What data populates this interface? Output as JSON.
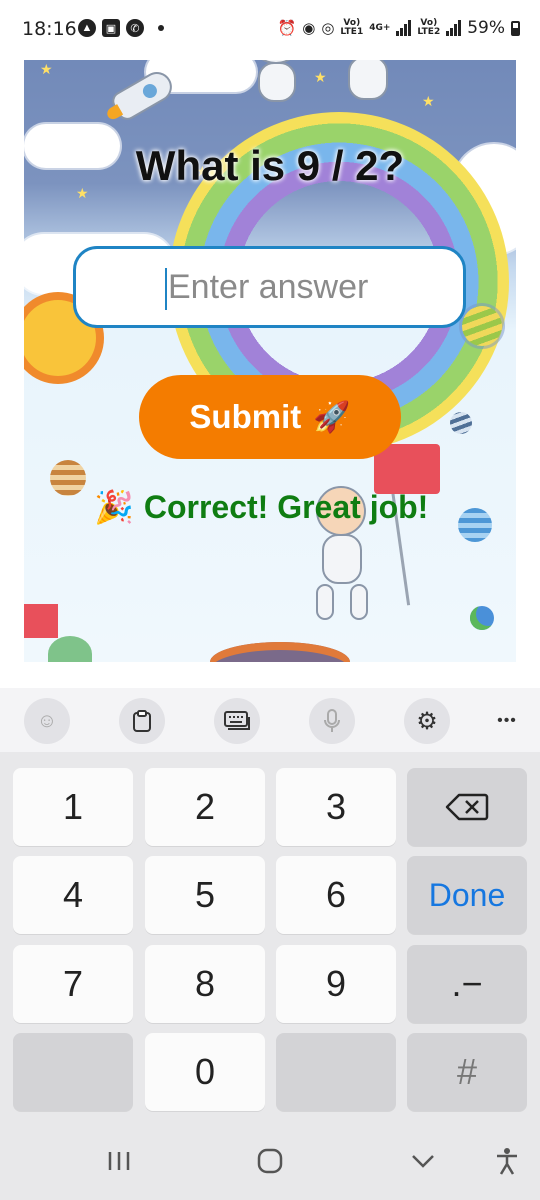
{
  "status_bar": {
    "time": "18:16",
    "battery": "59%",
    "net1_top": "Vo)",
    "net1_bottom": "LTE1",
    "net1_type": "4G+",
    "net2_top": "Vo)",
    "net2_bottom": "LTE2"
  },
  "app": {
    "question": "What is 9 / 2?",
    "answer_placeholder": "Enter answer",
    "submit_label": "Submit",
    "submit_emoji": "🚀",
    "feedback_emoji": "🎉",
    "feedback_text": "Correct! Great job!",
    "colors": {
      "submit_bg": "#f47c00",
      "feedback": "#0f7d12",
      "input_border": "#1f84c4"
    }
  },
  "keyboard": {
    "toolbar_icons": [
      "emoji-icon",
      "clipboard-icon",
      "keyboard-icon",
      "mic-icon",
      "settings-icon",
      "more-icon"
    ],
    "more_label": "•••",
    "keys": {
      "k1": "1",
      "k2": "2",
      "k3": "3",
      "k4": "4",
      "k5": "5",
      "k6": "6",
      "k7": "7",
      "k8": "8",
      "k9": "9",
      "k0": "0",
      "done": "Done",
      "dot_dash": ".−",
      "hash": "#"
    },
    "done_color": "#1677e0"
  }
}
